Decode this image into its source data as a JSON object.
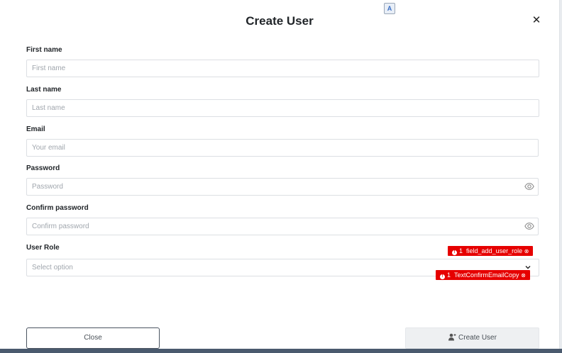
{
  "modal": {
    "title": "Create User"
  },
  "form": {
    "first_name": {
      "label": "First name",
      "placeholder": "First name"
    },
    "last_name": {
      "label": "Last name",
      "placeholder": "Last name"
    },
    "email": {
      "label": "Email",
      "placeholder": "Your email"
    },
    "password": {
      "label": "Password",
      "placeholder": "Password"
    },
    "confirm_password": {
      "label": "Confirm password",
      "placeholder": "Confirm password"
    },
    "user_role": {
      "label": "User Role",
      "placeholder": "Select option"
    }
  },
  "badges": [
    {
      "count": "1",
      "text": "field_add_user_role"
    },
    {
      "count": "1",
      "text": "TextConfirmEmailCopy"
    }
  ],
  "buttons": {
    "close_label": "Close",
    "create_label": "Create User"
  },
  "colors": {
    "badge": "#e60000",
    "border": "#dcdfe3"
  },
  "icons": {
    "close": "close-icon",
    "eye": "eye-icon",
    "chevron": "chevron-down-icon",
    "add_user": "add-user-icon",
    "translate": "translate-icon"
  }
}
